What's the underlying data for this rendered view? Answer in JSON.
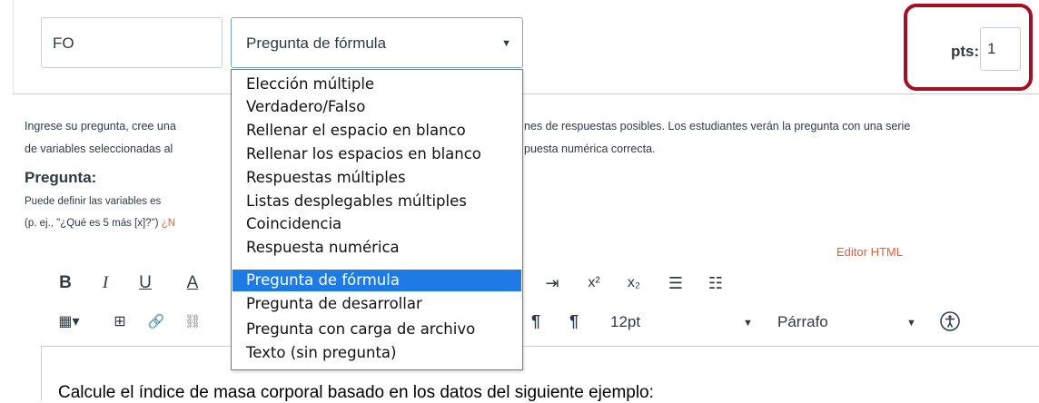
{
  "question_header": {
    "title_value": "FO",
    "type_selected": "Pregunta de fórmula",
    "points_label": "pts:",
    "points_value": "1"
  },
  "instructions": {
    "line1_left": "Ingrese su pregunta, cree una",
    "line1_right": "nes de respuestas posibles. Los estudiantes verán la pregunta con una serie",
    "line2_left": "de variables seleccionadas al",
    "line2_right": "puesta numérica correcta.",
    "question_heading": "Pregunta:",
    "hint1": "Puede definir las variables es",
    "hint2_prefix": "(p. ej., \"¿Qué es 5 más [x]?\")",
    "hint2_link": " ¿N",
    "editor_html_link": "Editor HTML"
  },
  "toolbar": {
    "row1": {
      "bold": "B",
      "italic": "I",
      "underline": "U",
      "font_color": "A",
      "indent_icon": "⇥",
      "superscript": "x²",
      "subscript": "x₂",
      "bulleted_list": "☰",
      "numbered_list": "☷"
    },
    "row2": {
      "table": "▦▾",
      "media": "⊞",
      "link": "🔗",
      "unlink": "⛓",
      "ltr": "¶",
      "rtl": "¶",
      "font_size": "12pt",
      "paragraph": "Párrafo"
    }
  },
  "editor_content": "Calcule el índice de masa corporal basado en los datos del siguiente ejemplo:",
  "question_type_options": [
    "Elección múltiple",
    "Verdadero/Falso",
    "Rellenar el espacio en blanco",
    "Rellenar los espacios en blanco",
    "Respuestas múltiples",
    "Listas desplegables múltiples",
    "Coincidencia",
    "Respuesta numérica",
    "Pregunta de fórmula",
    "Pregunta de desarrollar",
    "Pregunta con carga de archivo",
    "Texto (sin pregunta)"
  ],
  "selected_option_index": 8,
  "colors": {
    "highlight_border": "#a50f22",
    "selected_option": "#1e7be6",
    "link_orange": "#e66135"
  }
}
